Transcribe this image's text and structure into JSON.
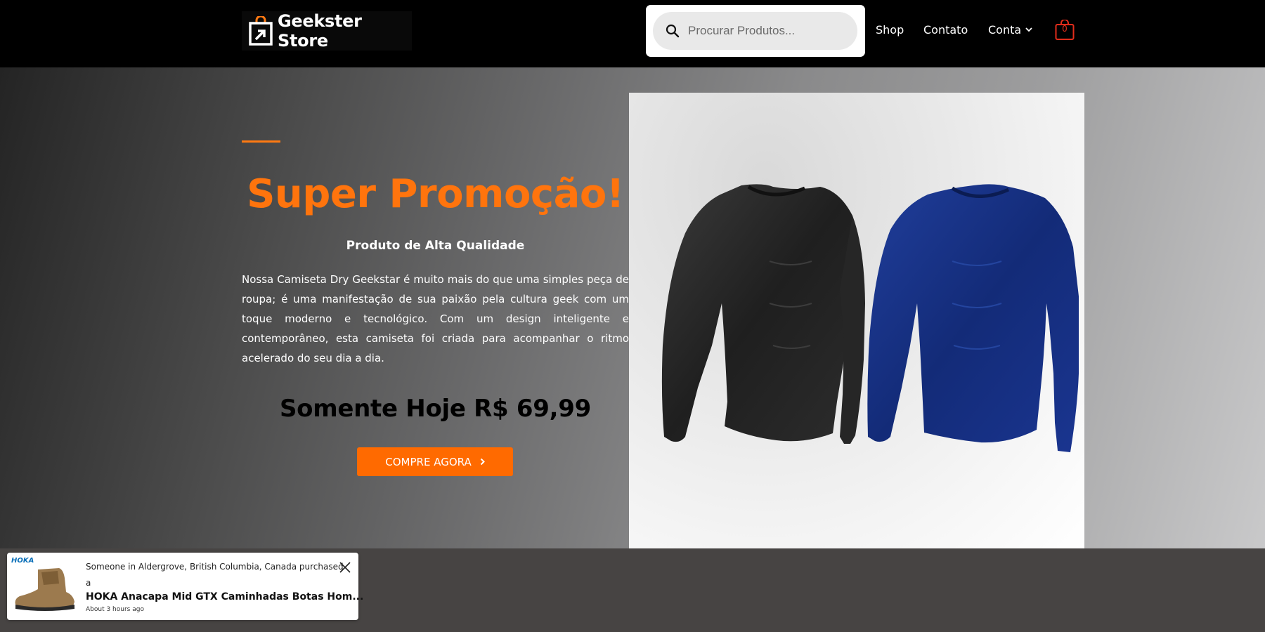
{
  "header": {
    "logo_text": "Geekster Store",
    "search": {
      "placeholder": "Procurar Produtos..."
    },
    "nav": {
      "shop": "Shop",
      "contato": "Contato",
      "conta": "Conta"
    },
    "cart": {
      "count": "0"
    }
  },
  "hero": {
    "title": "Super Promoção!",
    "subtitle": "Produto de Alta Qualidade",
    "description": "Nossa Camiseta Dry Geekstar é muito mais do que uma simples peça de roupa; é uma manifestação de sua paixão pela cultura geek com um toque moderno e tecnológico. Com um design inteligente e contemporâneo, esta camiseta foi criada para acompanhar o ritmo acelerado do seu dia a dia.",
    "price": "Somente Hoje R$ 69,99",
    "button_label": "COMPRE AGORA"
  },
  "notification": {
    "brand": "HOKA",
    "line1": "Someone in Aldergrove, British Columbia, Canada purchased",
    "line2": "a",
    "product": "HOKA Anacapa Mid GTX Caminhadas Botas Hom...",
    "time": "About 3 hours ago"
  },
  "colors": {
    "accent": "#ff740d",
    "button": "#ff6a00",
    "cart": "#e22d1b",
    "header_bg": "#000000"
  },
  "icons": [
    "logo-bag-icon",
    "search-icon",
    "chevron-down-icon",
    "cart-icon",
    "chevron-right-icon",
    "close-icon"
  ]
}
